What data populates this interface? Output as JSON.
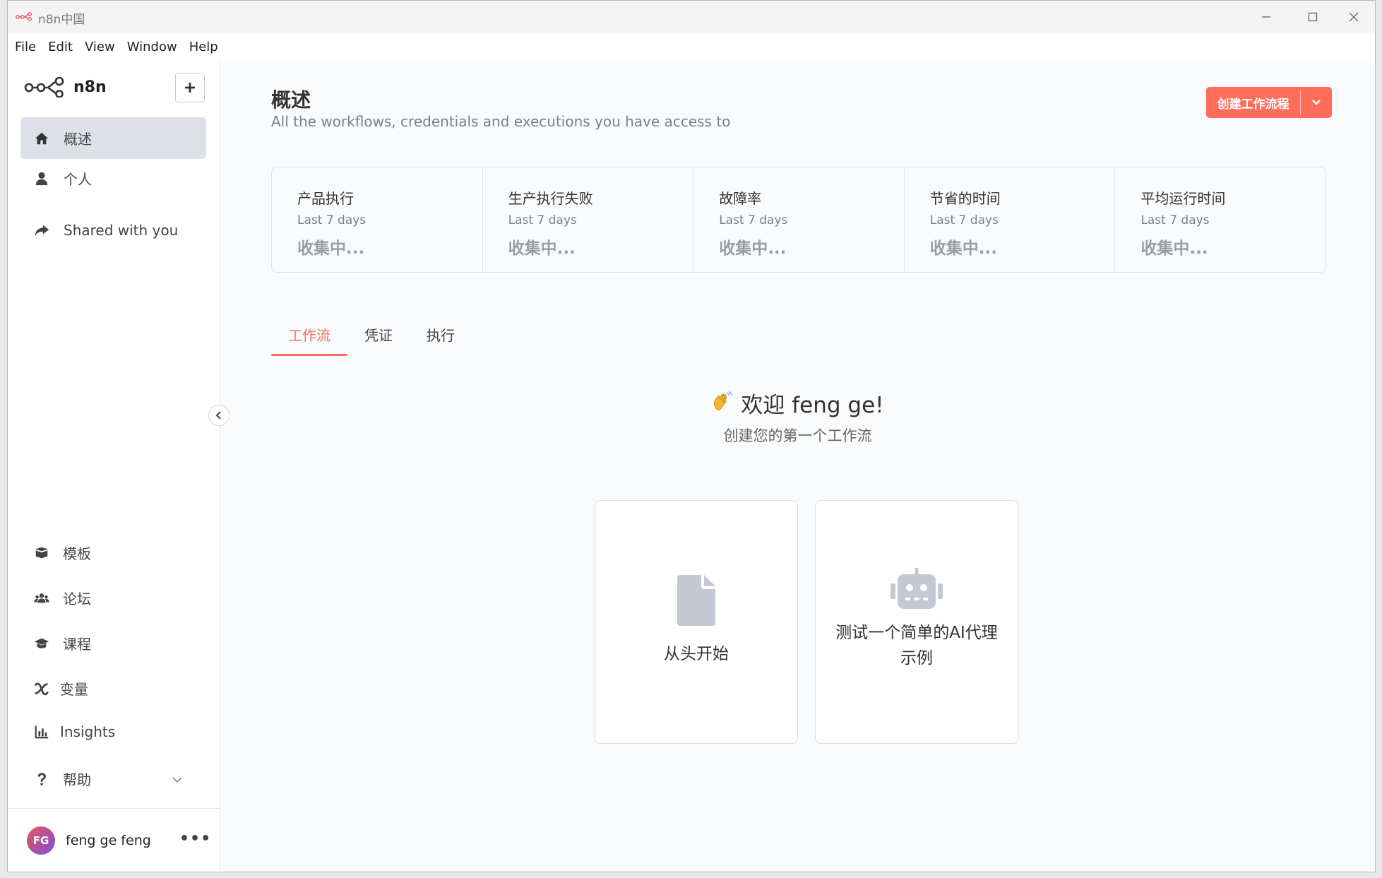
{
  "window": {
    "title": "n8n中国"
  },
  "menu": [
    "File",
    "Edit",
    "View",
    "Window",
    "Help"
  ],
  "sidebar": {
    "logo_text": "n8n",
    "nav": [
      {
        "label": "概述",
        "icon": "home-icon"
      },
      {
        "label": "个人",
        "icon": "user-icon"
      },
      {
        "label": "Shared with you",
        "icon": "share-icon"
      }
    ],
    "bottom_nav": [
      {
        "label": "模板",
        "icon": "templates-icon"
      },
      {
        "label": "论坛",
        "icon": "users-icon"
      },
      {
        "label": "课程",
        "icon": "graduation-cap-icon"
      },
      {
        "label": "变量",
        "icon": "variable-icon"
      },
      {
        "label": "Insights",
        "icon": "chart-icon"
      },
      {
        "label": "帮助",
        "icon": "question-icon"
      }
    ],
    "user": {
      "initials": "FG",
      "name": "feng ge feng",
      "more": "•••"
    }
  },
  "main": {
    "title": "概述",
    "subtitle": "All the workflows, credentials and executions you have access to",
    "create_button": "创建工作流程",
    "stats": [
      {
        "title": "产品执行",
        "period": "Last 7 days",
        "value": "收集中..."
      },
      {
        "title": "生产执行失败",
        "period": "Last 7 days",
        "value": "收集中..."
      },
      {
        "title": "故障率",
        "period": "Last 7 days",
        "value": "收集中..."
      },
      {
        "title": "节省的时间",
        "period": "Last 7 days",
        "value": "收集中..."
      },
      {
        "title": "平均运行时间",
        "period": "Last 7 days",
        "value": "收集中..."
      }
    ],
    "tabs": [
      "工作流",
      "凭证",
      "执行"
    ],
    "welcome": "欢迎 feng ge!",
    "welcome_sub": "创建您的第一个工作流",
    "cards": [
      {
        "label": "从头开始",
        "icon": "file-icon"
      },
      {
        "label": "测试一个简单的AI代理示例",
        "icon": "robot-icon"
      }
    ]
  },
  "colors": {
    "accent": "#ff6d5a",
    "active_nav_bg": "#dde0e8",
    "icon_gray": "#c5c8d3"
  }
}
